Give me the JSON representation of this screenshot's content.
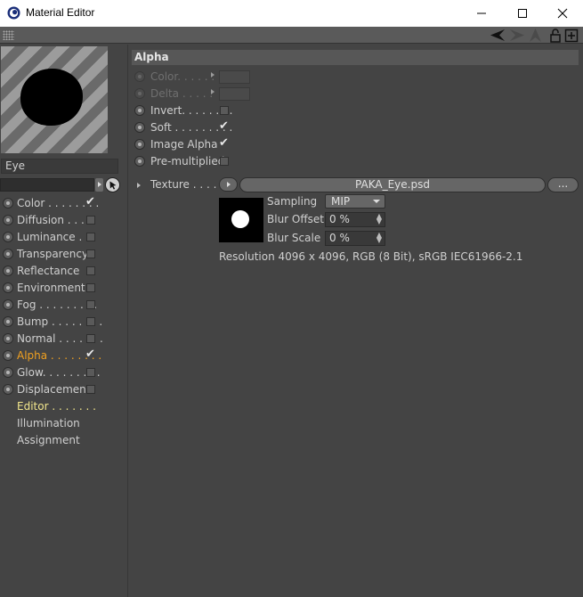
{
  "window": {
    "title": "Material Editor"
  },
  "left": {
    "material_name": "Eye",
    "channels": [
      {
        "label": "Color . . . . . . . .",
        "checked": true
      },
      {
        "label": "Diffusion . . . .",
        "checked": false
      },
      {
        "label": "Luminance . .",
        "checked": false
      },
      {
        "label": "Transparency",
        "checked": false
      },
      {
        "label": "Reflectance",
        "checked": false
      },
      {
        "label": "Environment",
        "checked": false
      },
      {
        "label": "Fog . . . . . . . . .",
        "checked": false
      },
      {
        "label": "Bump . . . . . . . .",
        "checked": false
      },
      {
        "label": "Normal . . . . . . .",
        "checked": false
      },
      {
        "label": "Alpha . . . . . . . .",
        "checked": true
      },
      {
        "label": "Glow. . . . . . . . .",
        "checked": false
      },
      {
        "label": "Displacement",
        "checked": false
      }
    ],
    "extras": [
      "Editor . . . . . . .",
      "Illumination",
      "Assignment"
    ]
  },
  "alpha": {
    "section_title": "Alpha",
    "params": [
      {
        "label": "Color. . . . . .",
        "type": "color",
        "enabled": false
      },
      {
        "label": "Delta . . . . .",
        "type": "color",
        "enabled": false
      },
      {
        "label": "Invert. . . . . . . .",
        "type": "check",
        "checked": false
      },
      {
        "label": "Soft . . . . . . . . .",
        "type": "check",
        "checked": true
      },
      {
        "label": "Image Alpha",
        "type": "check",
        "checked": true
      },
      {
        "label": "Pre-multiplied",
        "type": "check",
        "checked": false
      }
    ],
    "texture": {
      "label": "Texture . . . . .",
      "file": "PAKA_Eye.psd",
      "more": "...",
      "sampling_label": "Sampling",
      "sampling_value": "MIP",
      "blur_offset_label": "Blur Offset",
      "blur_offset_value": "0 %",
      "blur_scale_label": "Blur Scale",
      "blur_scale_value": "0 %",
      "resolution": "Resolution 4096 x 4096, RGB (8 Bit), sRGB IEC61966-2.1"
    }
  },
  "colors": {
    "background": "#444444",
    "active_channel": "#f0a020",
    "editor_label": "#f2e68c"
  }
}
